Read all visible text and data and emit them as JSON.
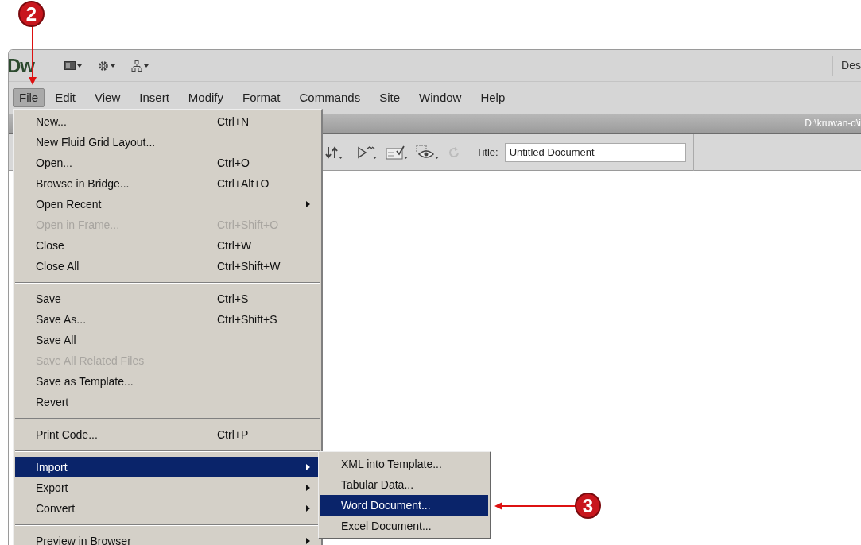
{
  "annotations": [
    {
      "label": "2"
    },
    {
      "label": "3"
    }
  ],
  "app_bar": {
    "logo": "Dw",
    "workspace": "Des"
  },
  "menu_bar": [
    {
      "label": "File",
      "selected": true
    },
    {
      "label": "Edit",
      "selected": false
    },
    {
      "label": "View",
      "selected": false
    },
    {
      "label": "Insert",
      "selected": false
    },
    {
      "label": "Modify",
      "selected": false
    },
    {
      "label": "Format",
      "selected": false
    },
    {
      "label": "Commands",
      "selected": false
    },
    {
      "label": "Site",
      "selected": false
    },
    {
      "label": "Window",
      "selected": false
    },
    {
      "label": "Help",
      "selected": false
    }
  ],
  "document_tab": {
    "path": "D:\\kruwan-d\\i"
  },
  "toolbar": {
    "title_label": "Title:",
    "title_value": "Untitled Document"
  },
  "file_menu": [
    {
      "kind": "item",
      "label": "New...",
      "shortcut": "Ctrl+N",
      "disabled": false,
      "selected": false,
      "submenu": false
    },
    {
      "kind": "item",
      "label": "New Fluid Grid Layout...",
      "disabled": false,
      "selected": false,
      "submenu": false
    },
    {
      "kind": "item",
      "label": "Open...",
      "shortcut": "Ctrl+O",
      "disabled": false,
      "selected": false,
      "submenu": false
    },
    {
      "kind": "item",
      "label": "Browse in Bridge...",
      "shortcut": "Ctrl+Alt+O",
      "disabled": false,
      "selected": false,
      "submenu": false
    },
    {
      "kind": "item",
      "label": "Open Recent",
      "disabled": false,
      "selected": false,
      "submenu": true
    },
    {
      "kind": "item",
      "label": "Open in Frame...",
      "shortcut": "Ctrl+Shift+O",
      "disabled": true,
      "selected": false,
      "submenu": false
    },
    {
      "kind": "item",
      "label": "Close",
      "shortcut": "Ctrl+W",
      "disabled": false,
      "selected": false,
      "submenu": false
    },
    {
      "kind": "item",
      "label": "Close All",
      "shortcut": "Ctrl+Shift+W",
      "disabled": false,
      "selected": false,
      "submenu": false
    },
    {
      "kind": "separator"
    },
    {
      "kind": "item",
      "label": "Save",
      "shortcut": "Ctrl+S",
      "disabled": false,
      "selected": false,
      "submenu": false
    },
    {
      "kind": "item",
      "label": "Save As...",
      "shortcut": "Ctrl+Shift+S",
      "disabled": false,
      "selected": false,
      "submenu": false
    },
    {
      "kind": "item",
      "label": "Save All",
      "disabled": false,
      "selected": false,
      "submenu": false
    },
    {
      "kind": "item",
      "label": "Save All Related Files",
      "disabled": true,
      "selected": false,
      "submenu": false
    },
    {
      "kind": "item",
      "label": "Save as Template...",
      "disabled": false,
      "selected": false,
      "submenu": false
    },
    {
      "kind": "item",
      "label": "Revert",
      "disabled": false,
      "selected": false,
      "submenu": false
    },
    {
      "kind": "separator"
    },
    {
      "kind": "item",
      "label": "Print Code...",
      "shortcut": "Ctrl+P",
      "disabled": false,
      "selected": false,
      "submenu": false
    },
    {
      "kind": "separator"
    },
    {
      "kind": "item",
      "label": "Import",
      "disabled": false,
      "selected": true,
      "submenu": true
    },
    {
      "kind": "item",
      "label": "Export",
      "disabled": false,
      "selected": false,
      "submenu": true
    },
    {
      "kind": "item",
      "label": "Convert",
      "disabled": false,
      "selected": false,
      "submenu": true
    },
    {
      "kind": "separator"
    },
    {
      "kind": "item",
      "label": "Preview in Browser",
      "disabled": false,
      "selected": false,
      "submenu": true
    }
  ],
  "import_submenu": [
    {
      "label": "XML into Template...",
      "selected": false
    },
    {
      "label": "Tabular Data...",
      "selected": false
    },
    {
      "label": "Word Document...",
      "selected": true
    },
    {
      "label": "Excel Document...",
      "selected": false
    }
  ]
}
